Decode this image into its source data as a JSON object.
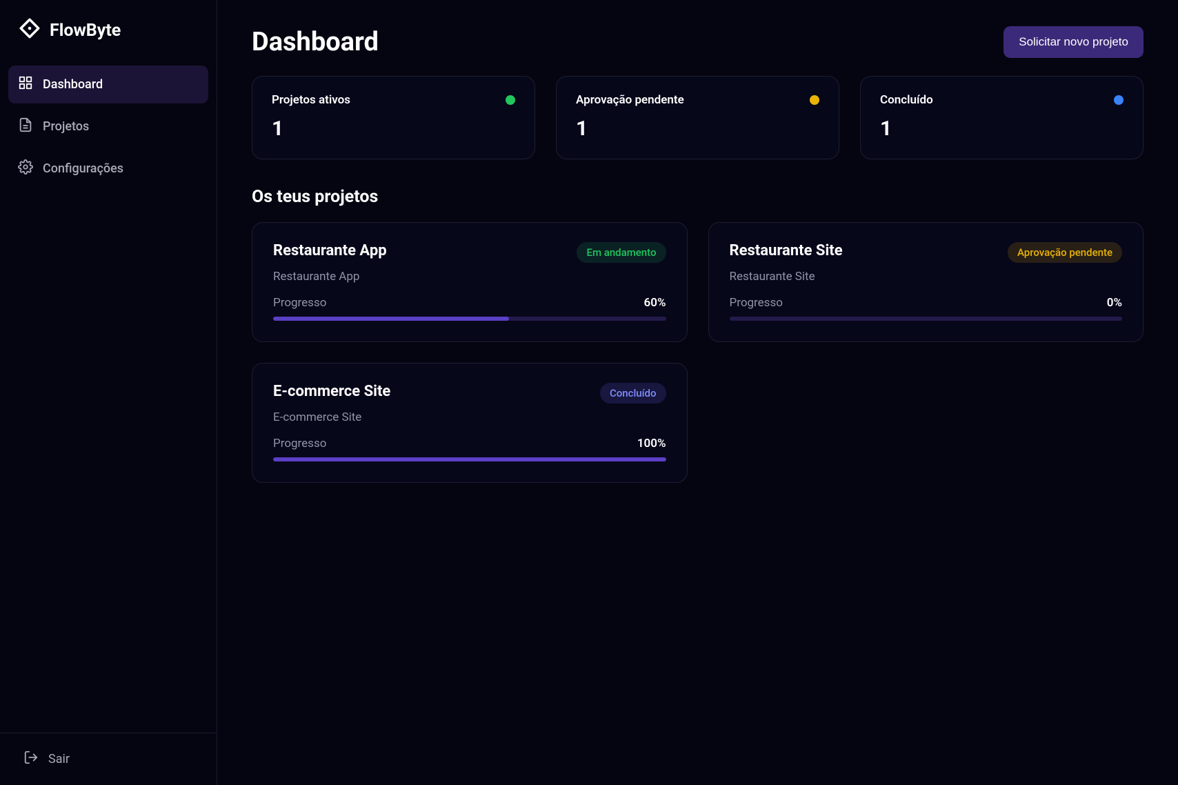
{
  "brand": "FlowByte",
  "nav": {
    "dashboard": "Dashboard",
    "projects": "Projetos",
    "settings": "Configurações"
  },
  "logout_label": "Sair",
  "header": {
    "title": "Dashboard",
    "cta": "Solicitar novo projeto"
  },
  "stats": {
    "active": {
      "label": "Projetos ativos",
      "value": "1",
      "dot": "green"
    },
    "pending": {
      "label": "Aprovação pendente",
      "value": "1",
      "dot": "yellow"
    },
    "done": {
      "label": "Concluído",
      "value": "1",
      "dot": "blue"
    }
  },
  "projects_section_title": "Os teus projetos",
  "progress_label": "Progresso",
  "projects": [
    {
      "title": "Restaurante App",
      "subtitle": "Restaurante App",
      "status_label": "Em andamento",
      "status_variant": "green",
      "progress_pct": 60,
      "progress_text": "60%"
    },
    {
      "title": "Restaurante Site",
      "subtitle": "Restaurante Site",
      "status_label": "Aprovação pendente",
      "status_variant": "yellow",
      "progress_pct": 0,
      "progress_text": "0%"
    },
    {
      "title": "E-commerce Site",
      "subtitle": "E-commerce Site",
      "status_label": "Concluído",
      "status_variant": "blue",
      "progress_pct": 100,
      "progress_text": "100%"
    }
  ]
}
